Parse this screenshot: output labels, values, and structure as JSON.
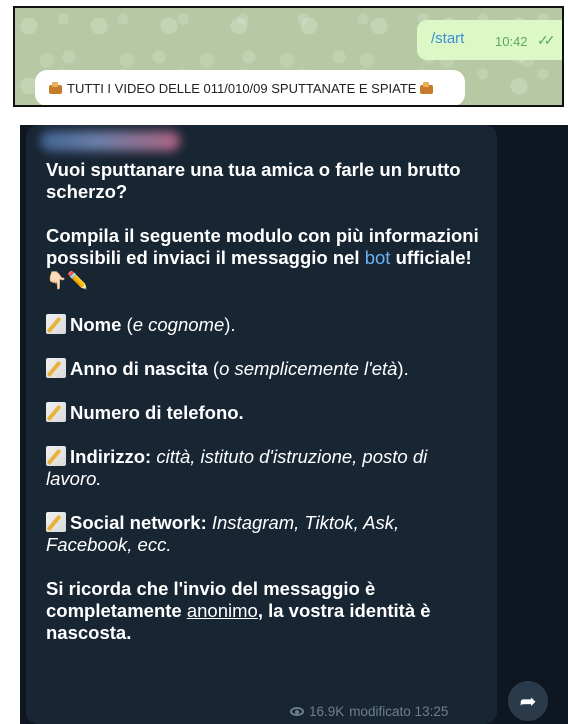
{
  "outgoing_message": {
    "text": "/start",
    "time": "10:42",
    "status_icon": "double-check-icon"
  },
  "banner": {
    "icon": "movie-camera-icon",
    "text": "TUTTI I VIDEO DELLE 011/010/09 SPUTTANATE E SPIATE"
  },
  "post": {
    "intro": "Vuoi sputtanare una tua amica o farle un brutto scherzo?",
    "instruction_a": "Compila il seguente modulo con più informazioni possibili ed inviaci il messaggio nel ",
    "instruction_link": "bot",
    "instruction_b": " ufficiale!",
    "instruction_emoji": "👇🏻✏️",
    "fields": [
      {
        "label": "Nome",
        "hint": "(e cognome)",
        "hint_italic": "e cognome",
        "suffix": "."
      },
      {
        "label": "Anno di nascita",
        "hint_italic": "o semplicemente l'età"
      },
      {
        "label": "Numero di telefono."
      },
      {
        "label": "Indirizzo:",
        "hint_italic": "città, istituto d'istruzione, posto di lavoro."
      },
      {
        "label": "Social network:",
        "hint_italic": "Instagram, Tiktok, Ask, Facebook, ecc."
      }
    ],
    "closing_a": "Si ricorda che l'invio del messaggio è completamente ",
    "closing_u": "anonimo",
    "closing_b": ", la vostra identità è nascosta.",
    "views": "16.9K",
    "edited": "modificato 13:25"
  },
  "colors": {
    "chat_dark_bg": "#0e1621",
    "bubble_bg": "#182533",
    "link": "#6ab3f3",
    "out_bubble": "#dcf8c6"
  }
}
